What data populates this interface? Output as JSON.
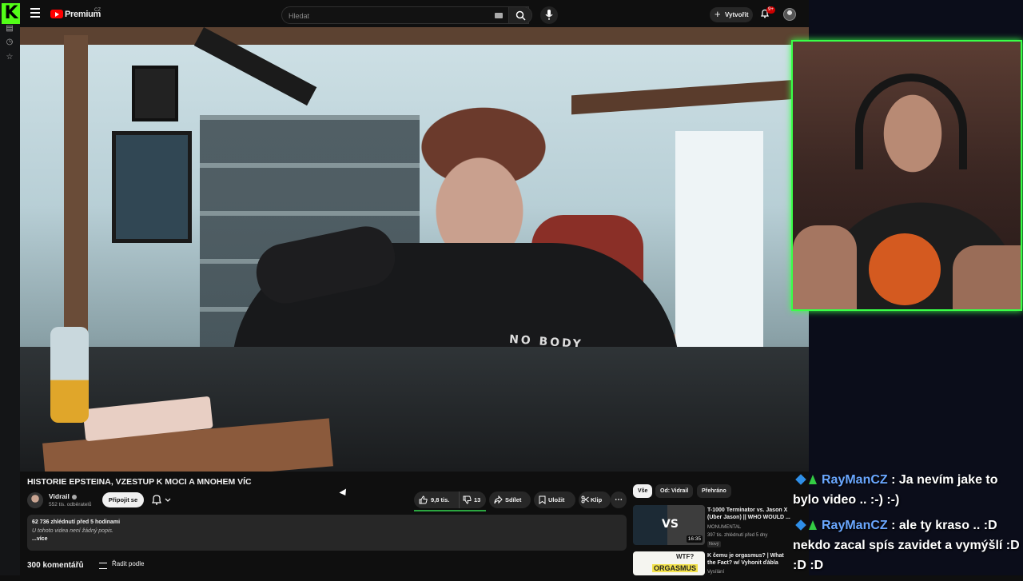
{
  "header": {
    "brand": "Premium",
    "region": "CZ",
    "search_placeholder": "Hledat",
    "create_label": "Vytvořit",
    "notifications_badge": "9+"
  },
  "video": {
    "title": "HISTORIE EPSTEINA, VZESTUP K MOCI A MNOHEM VÍC",
    "shirt_text": "NO BODY",
    "channel": {
      "name": "Vidrail",
      "subscribers": "552 tis. odběratelů",
      "join_label": "Připojit se"
    },
    "actions": {
      "likes": "9,8 tis.",
      "dislikes": "13",
      "share": "Sdílet",
      "save": "Uložit",
      "clip": "Klip",
      "more": "⋯"
    },
    "description": {
      "stats": "62 736 zhlédnutí  před 5 hodinami",
      "text": "U tohoto videa není žádný popis.",
      "more": "...více"
    },
    "comments": {
      "count": "300 komentářů",
      "sort_label": "Řadit podle"
    }
  },
  "recommendations": {
    "chips": [
      "Vše",
      "Od: Vidrail",
      "Přehráno"
    ],
    "items": [
      {
        "thumb_text": "VS",
        "title": "T-1000 Terminator vs. Jason X (Uber Jason) || WHO WOULD ...",
        "channel": "MONUMENTAL",
        "meta": "397 tis. zhlédnutí  před 5 dny",
        "duration": "16:35",
        "badge": "Nový"
      },
      {
        "thumb_text": "ORGASMUS",
        "thumb_text2": "WTF?",
        "title": "K čemu je orgasmus? | What the Fact? w/ Vyhonit ďábla",
        "channel": "Vysílání"
      }
    ]
  },
  "chat": [
    {
      "user": "RayManCZ",
      "text": "Ja nevím jake to bylo video .. :-) :-)"
    },
    {
      "user": "RayManCZ",
      "text": "ale ty kraso .. :D nekdo zacal spís zavidet a vymýšlí :D :D :D"
    }
  ],
  "colors": {
    "kick_green": "#53fc18",
    "yt_red": "#ff0000",
    "webcam_border": "#39ff48",
    "chat_user": "#6aa7ff"
  }
}
